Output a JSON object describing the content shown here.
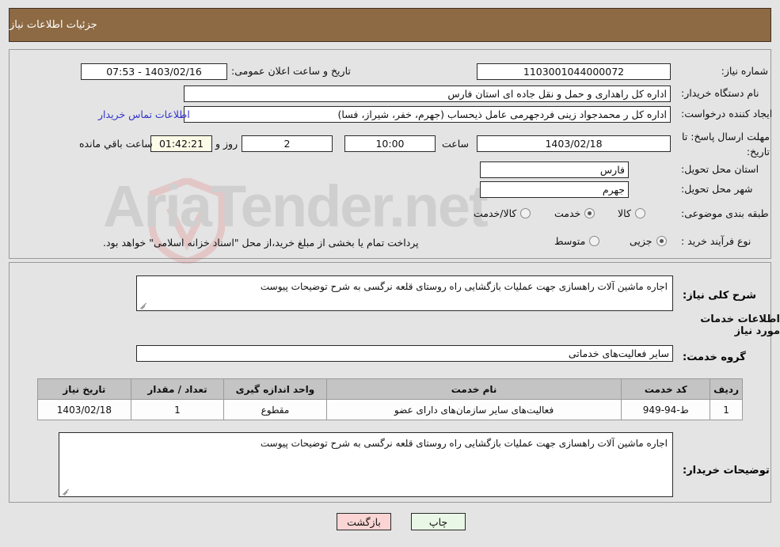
{
  "header": {
    "title": "جزئیات اطلاعات نیاز"
  },
  "form": {
    "need_number_label": "شماره نیاز:",
    "need_number_value": "1103001044000072",
    "announce_label": "تاریخ و ساعت اعلان عمومی:",
    "announce_value": "1403/02/16 - 07:53",
    "buyer_org_label": "نام دستگاه خریدار:",
    "buyer_org_value": "اداره کل راهداری و حمل و نقل جاده ای استان فارس",
    "requester_label": "ایجاد کننده درخواست:",
    "requester_value": "اداره کل ر محمدجواد زینی فردجهرمی عامل ذیحساب (جهرم، خفر، شیراز، فسا)",
    "contact_link": "اطلاعات تماس خریدار",
    "deadline_label": "مهلت ارسال پاسخ: تا تاریخ:",
    "deadline_date": "1403/02/18",
    "hour_word": "ساعت",
    "deadline_time": "10:00",
    "days_value": "2",
    "day_and_word": "روز و",
    "countdown_value": "01:42:21",
    "remaining_word": "ساعت باقي مانده",
    "province_label": "استان محل تحویل:",
    "province_value": "فارس",
    "city_label": "شهر محل تحویل:",
    "city_value": "جهرم",
    "category_label": "طبقه بندی موضوعی:",
    "category_options": [
      {
        "label": "کالا",
        "selected": false
      },
      {
        "label": "خدمت",
        "selected": true
      },
      {
        "label": "کالا/خدمت",
        "selected": false
      }
    ],
    "process_label": "نوع فرآیند خرید :",
    "process_options": [
      {
        "label": "جزیی",
        "selected": true
      },
      {
        "label": "متوسط",
        "selected": false
      }
    ],
    "payment_note": "پرداخت تمام یا بخشی از مبلغ خرید،از محل \"اسناد خزانه اسلامی\" خواهد بود."
  },
  "description": {
    "general_label": "شرح کلی نیاز:",
    "general_value": "اجاره ماشین آلات راهسازی جهت عملیات بازگشایی راه روستای قلعه نرگسی به شرح توضیحات پیوست",
    "services_heading": "اطلاعات خدمات مورد نیاز",
    "service_group_label": "گروه خدمت:",
    "service_group_value": "سایر فعالیت‌های خدماتی"
  },
  "table": {
    "columns": [
      "ردیف",
      "کد خدمت",
      "نام خدمت",
      "واحد اندازه گیری",
      "تعداد / مقدار",
      "تاریخ نیاز"
    ],
    "rows": [
      {
        "row_no": "1",
        "service_code": "ط-94-949",
        "service_name": "فعالیت‌های سایر سازمان‌های دارای عضو",
        "unit": "مقطوع",
        "quantity": "1",
        "need_date": "1403/02/18"
      }
    ]
  },
  "buyer_notes": {
    "label": "توضیحات خریدار:",
    "value": "اجاره ماشین آلات راهسازی جهت عملیات بازگشایی راه روستای قلعه نرگسی به شرح توضیحات پیوست"
  },
  "footer": {
    "print_label": "چاپ",
    "back_label": "بازگشت"
  },
  "watermark": {
    "text": "AriaTender.net"
  },
  "colors": {
    "header_bg": "#8d6a43",
    "page_bg": "#e4e4e4",
    "link": "#3333cc",
    "countdown_bg": "#fbfbe7",
    "print_btn_bg": "#e9f7e6",
    "back_btn_bg": "#fbd4d4",
    "table_header_bg": "#c4c4c4"
  }
}
